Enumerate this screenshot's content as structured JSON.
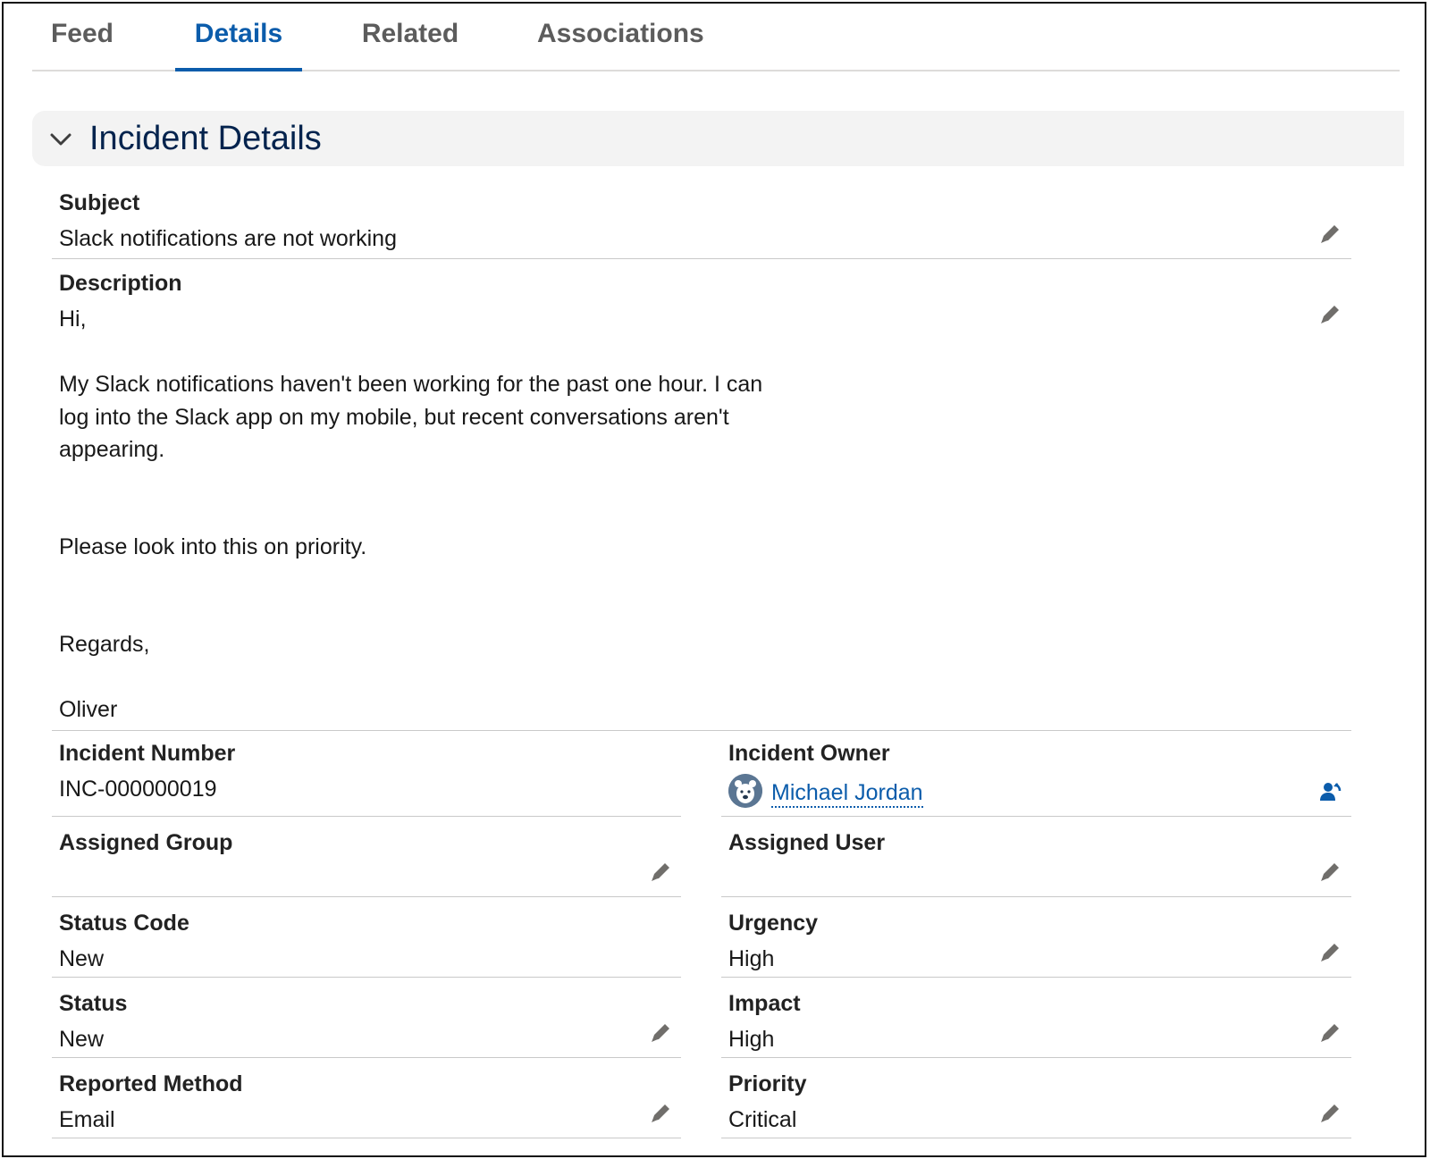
{
  "tabs": [
    {
      "label": "Feed",
      "active": false
    },
    {
      "label": "Details",
      "active": true
    },
    {
      "label": "Related",
      "active": false
    },
    {
      "label": "Associations",
      "active": false
    }
  ],
  "section": {
    "title": "Incident Details"
  },
  "fields": {
    "subject": {
      "label": "Subject",
      "value": "Slack notifications are not working"
    },
    "description": {
      "label": "Description",
      "lines": [
        "Hi,",
        "My Slack notifications haven't been working for the past one hour. I can",
        "log into the Slack app on my mobile, but recent conversations aren't",
        "appearing.",
        "Please look into this on priority.",
        "Regards,",
        "Oliver"
      ]
    },
    "incident_number": {
      "label": "Incident Number",
      "value": "INC-000000019"
    },
    "incident_owner": {
      "label": "Incident Owner",
      "value": "Michael Jordan"
    },
    "assigned_group": {
      "label": "Assigned Group",
      "value": ""
    },
    "assigned_user": {
      "label": "Assigned User",
      "value": ""
    },
    "status_code": {
      "label": "Status Code",
      "value": "New"
    },
    "urgency": {
      "label": "Urgency",
      "value": "High"
    },
    "status": {
      "label": "Status",
      "value": "New"
    },
    "impact": {
      "label": "Impact",
      "value": "High"
    },
    "reported_method": {
      "label": "Reported Method",
      "value": "Email"
    },
    "priority": {
      "label": "Priority",
      "value": "Critical"
    }
  },
  "colors": {
    "accent": "#0b5cab",
    "section_bg": "#f3f3f3",
    "title": "#03234d"
  }
}
